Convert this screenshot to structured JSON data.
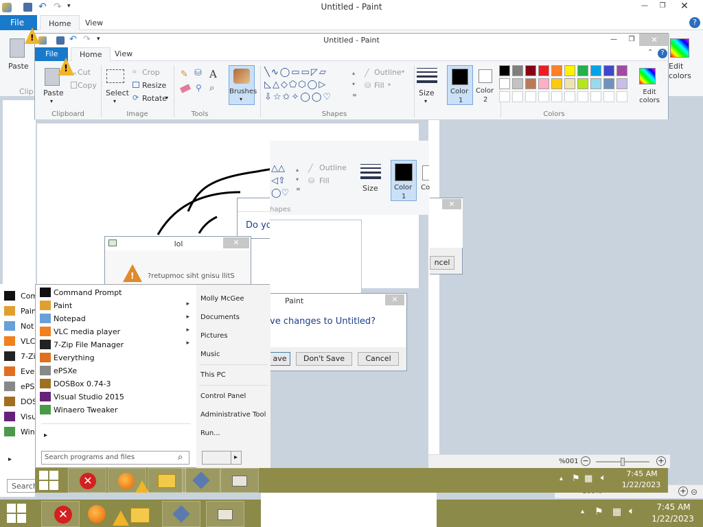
{
  "paint_back": {
    "title": "Untitled - Paint",
    "menu": {
      "file": "File",
      "home": "Home",
      "view": "View"
    },
    "paste": "Paste",
    "clipboard_partial": "Clip",
    "edit_colors": "Edit colors"
  },
  "paint_mid": {
    "title": "Untitled - Paint",
    "menu": {
      "file": "File",
      "home": "Home",
      "view": "View"
    },
    "clipboard": {
      "paste": "Paste",
      "cut": "Cut",
      "copy": "Copy",
      "label": "Clipboard"
    },
    "image": {
      "select": "Select",
      "crop": "Crop",
      "resize": "Resize",
      "rotate": "Rotate",
      "label": "Image"
    },
    "tools": {
      "label": "Tools",
      "text_tool": "A"
    },
    "brushes": "Brushes",
    "shapes": {
      "outline": "Outline",
      "fill": "Fill",
      "label": "Shapes"
    },
    "size": "Size",
    "color1": {
      "label": "Color",
      "num": "1"
    },
    "color2": {
      "label": "Color",
      "num": "2"
    },
    "edit_colors": "Edit colors",
    "colors_label": "Colors",
    "palette": [
      "#000000",
      "#7f7f7f",
      "#880015",
      "#ed1c24",
      "#ff7f27",
      "#fff200",
      "#22b14c",
      "#00a2e8",
      "#3f48cc",
      "#a349a4",
      "#ffffff",
      "#c3c3c3",
      "#b97a57",
      "#ffaec9",
      "#ffc90e",
      "#efe4b0",
      "#b5e61d",
      "#99d9ea",
      "#7092be",
      "#c8bfe7"
    ]
  },
  "paint_front": {
    "outline": "Outline",
    "fill": "Fill",
    "size": "Size",
    "color1": {
      "label": "Color",
      "num": "1"
    },
    "color2_partial": "Co",
    "shapes_partial": "hapes"
  },
  "lol_dialog": {
    "title": "lol",
    "message": "?retupmoc siht gnisu llitS"
  },
  "do_you_partial": "Do yo",
  "cancel_partial": "ncel",
  "save_dialog": {
    "title": "Paint",
    "message": "ve changes to Untitled?",
    "save_partial": "ave",
    "dont_save": "Don't Save",
    "cancel": "Cancel"
  },
  "start_menu": {
    "programs": [
      {
        "label": "Command Prompt",
        "icon": "cmd-icon",
        "arrow": ""
      },
      {
        "label": "Paint",
        "icon": "paint-icon",
        "arrow": "▸"
      },
      {
        "label": "Notepad",
        "icon": "notepad-icon",
        "arrow": "▸"
      },
      {
        "label": "VLC media player",
        "icon": "vlc-icon",
        "arrow": "▸"
      },
      {
        "label": "7-Zip File Manager",
        "icon": "7zip-icon",
        "arrow": "▸"
      },
      {
        "label": "Everything",
        "icon": "everything-icon",
        "arrow": ""
      },
      {
        "label": "ePSXe",
        "icon": "epsxe-icon",
        "arrow": ""
      },
      {
        "label": "DOSBox 0.74-3",
        "icon": "dosbox-icon",
        "arrow": ""
      },
      {
        "label": "Visual Studio 2015",
        "icon": "visual-studio-icon",
        "arrow": ""
      },
      {
        "label": "Winaero Tweaker",
        "icon": "winaero-icon",
        "arrow": ""
      }
    ],
    "all_programs_arrow": "▸",
    "search_placeholder": "Search programs and files",
    "right": {
      "user": "Molly McGee",
      "documents": "Documents",
      "pictures": "Pictures",
      "music": "Music",
      "this_pc": "This PC",
      "control_panel": "Control Panel",
      "admin_tools": "Administrative Tool",
      "run": "Run..."
    },
    "shutdown_arrow": "▸"
  },
  "back_start_items": [
    "Com",
    "Pain",
    "Not",
    "VLC",
    "7-Zi",
    "Ever",
    "ePS",
    "DOS",
    "Visu",
    "Win"
  ],
  "back_search_partial": "Search",
  "statusbar": {
    "zoom": "100%"
  },
  "zoom_mirrored": "%001",
  "tray": {
    "time": "7:45 AM",
    "date": "1/22/2023"
  },
  "tray_mid": {
    "time": "7:45 AM",
    "date": "1/22/2023"
  }
}
